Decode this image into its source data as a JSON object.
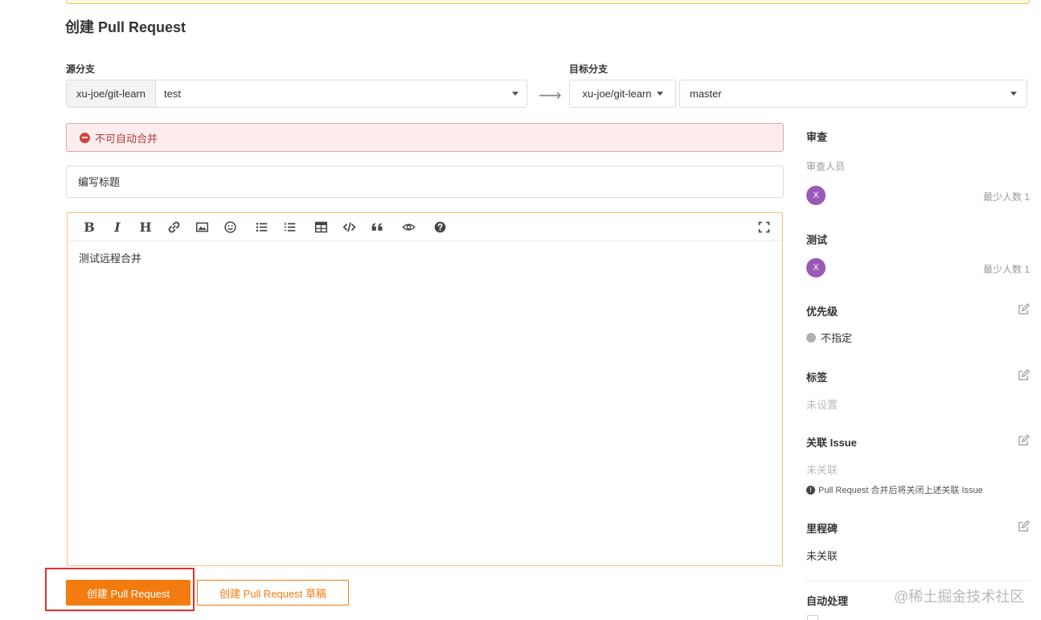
{
  "page": {
    "title": "创建 Pull Request"
  },
  "source": {
    "label": "源分支",
    "repo": "xu-joe/git-learn",
    "branch": "test"
  },
  "target": {
    "label": "目标分支",
    "repo": "xu-joe/git-learn",
    "branch": "master"
  },
  "arrow_glyph": "⟶",
  "alert": {
    "text": "不可自动合并"
  },
  "title_field": {
    "placeholder": "编写标题"
  },
  "toolbar": {
    "bold": "B",
    "italic": "I",
    "heading": "H",
    "tools": [
      "bold-icon",
      "italic-icon",
      "heading-icon",
      "link-icon",
      "image-icon",
      "emoji-icon",
      "unordered-list-icon",
      "ordered-list-icon",
      "table-icon",
      "code-icon",
      "quote-icon",
      "preview-icon",
      "help-icon",
      "fullscreen-icon"
    ]
  },
  "editor": {
    "content": "测试远程合并"
  },
  "buttons": {
    "create": "创建 Pull Request",
    "draft": "创建 Pull Request 草稿"
  },
  "sidebar": {
    "review": {
      "heading": "审查",
      "sub": "审查人员",
      "avatar": "X",
      "min": "最少人数 1"
    },
    "test": {
      "heading": "测试",
      "avatar": "X",
      "min": "最少人数 1"
    },
    "priority": {
      "heading": "优先级",
      "value": "不指定"
    },
    "labels": {
      "heading": "标签",
      "value": "未设置"
    },
    "issue": {
      "heading": "关联 Issue",
      "value": "未关联",
      "note": "Pull Request 合并后将关闭上述关联 Issue"
    },
    "milestone": {
      "heading": "里程碑",
      "value": "未关联"
    },
    "auto": {
      "heading": "自动处理"
    }
  },
  "colors": {
    "accent": "#f37c10",
    "avatar": "#9b59b6",
    "alert_text": "#b03a3a",
    "highlight": "#e0302a"
  },
  "watermark": "@稀土掘金技术社区"
}
